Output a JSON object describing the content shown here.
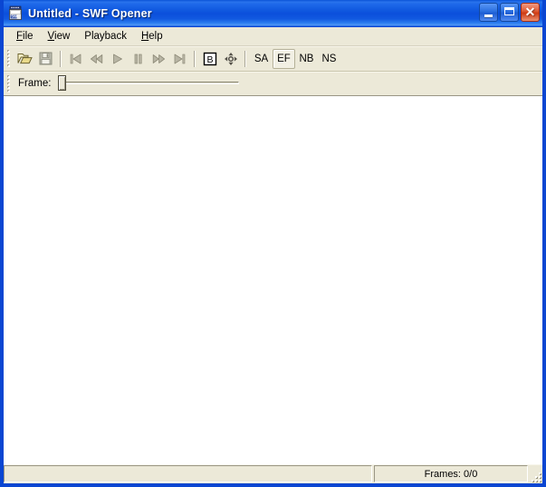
{
  "window": {
    "title": "Untitled - SWF Opener",
    "icon": "swf-film-icon",
    "controls": {
      "minimize": "Minimize",
      "maximize": "Maximize",
      "close": "Close",
      "close_glyph": "✕"
    },
    "colors": {
      "title_gradient_start": "#0a53d8",
      "title_gradient_end": "#1b62e2",
      "frame_border": "#0a46d2",
      "toolbar_face": "#ece9d8",
      "canvas": "#ffffff",
      "close_button": "#cf3a13"
    }
  },
  "menubar": {
    "items": [
      {
        "label": "File",
        "accel": "F",
        "name": "menu-file"
      },
      {
        "label": "View",
        "accel": "V",
        "name": "menu-view"
      },
      {
        "label": "Playback",
        "accel": "",
        "name": "menu-playback"
      },
      {
        "label": "Help",
        "accel": "H",
        "name": "menu-help"
      }
    ]
  },
  "toolbar": {
    "buttons": [
      {
        "name": "open-file-button",
        "icon": "open-folder-icon",
        "label": "",
        "enabled": true,
        "active": false
      },
      {
        "name": "save-file-button",
        "icon": "save-disk-icon",
        "label": "",
        "enabled": false,
        "active": false
      },
      {
        "name": "skip-to-start-button",
        "icon": "skip-back-icon",
        "label": "",
        "enabled": false,
        "active": false
      },
      {
        "name": "rewind-button",
        "icon": "rewind-icon",
        "label": "",
        "enabled": false,
        "active": false
      },
      {
        "name": "play-button",
        "icon": "play-icon",
        "label": "",
        "enabled": false,
        "active": false
      },
      {
        "name": "pause-button",
        "icon": "pause-icon",
        "label": "",
        "enabled": false,
        "active": false
      },
      {
        "name": "fast-forward-button",
        "icon": "fast-forward-icon",
        "label": "",
        "enabled": false,
        "active": false
      },
      {
        "name": "skip-to-end-button",
        "icon": "skip-forward-icon",
        "label": "",
        "enabled": false,
        "active": false
      },
      {
        "name": "boxed-b-button",
        "icon": "boxed-b-icon",
        "label": "",
        "enabled": true,
        "active": false
      },
      {
        "name": "pan-move-button",
        "icon": "four-arrow-move-icon",
        "label": "",
        "enabled": true,
        "active": false
      }
    ],
    "mode_buttons": [
      {
        "name": "show-all-button",
        "label": "SA",
        "active": false
      },
      {
        "name": "exact-fit-button",
        "label": "EF",
        "active": true
      },
      {
        "name": "no-border-button",
        "label": "NB",
        "active": false
      },
      {
        "name": "no-scale-button",
        "label": "NS",
        "active": false
      }
    ]
  },
  "framebar": {
    "label": "Frame:",
    "slider": {
      "name": "frame-slider",
      "value": 0,
      "min": 0,
      "max": 0,
      "thumb_position_percent": 0
    }
  },
  "statusbar": {
    "left_text": "",
    "right_text": "Frames: 0/0"
  }
}
